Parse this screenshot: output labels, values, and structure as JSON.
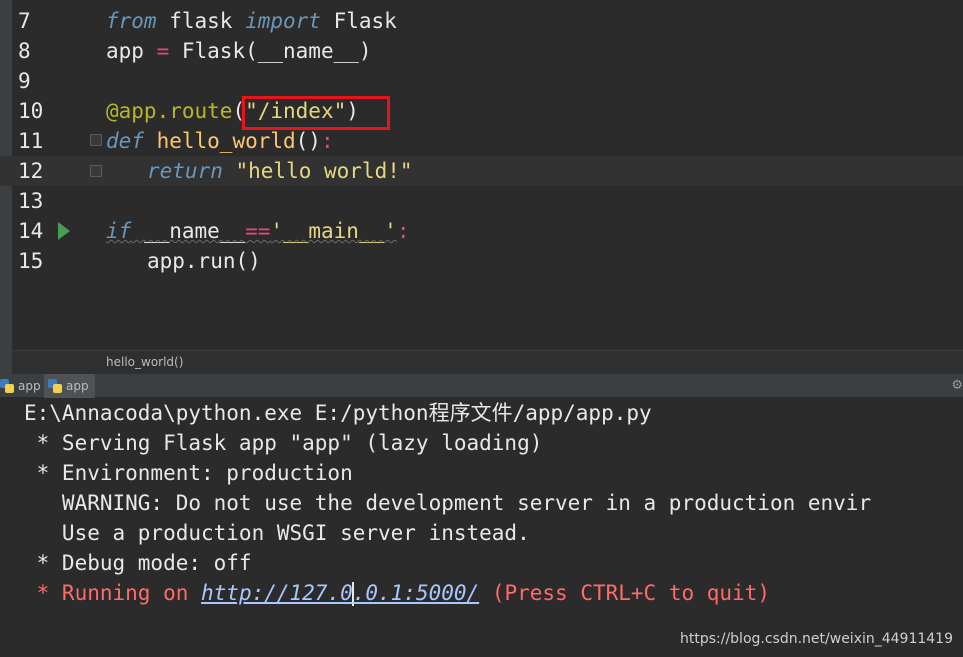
{
  "editor": {
    "lines": [
      {
        "no": "7",
        "code": {
          "kw1": "from",
          "mod": " flask ",
          "kw2": "import",
          "name": " Flask"
        }
      },
      {
        "no": "8",
        "code": {
          "lhs": "app ",
          "op": "=",
          "rhs": " Flask(__name__)"
        }
      },
      {
        "no": "9"
      },
      {
        "no": "10",
        "code": {
          "decorator": "@app.route",
          "paren_open": "(",
          "string": "\"/index\"",
          "paren_close": ")"
        }
      },
      {
        "no": "11",
        "code": {
          "kw": "def",
          "fn": " hello_world",
          "paren": "()",
          "colon": ":"
        }
      },
      {
        "no": "12",
        "code": {
          "kw": "return",
          "string": " \"hello world!\""
        }
      },
      {
        "no": "13"
      },
      {
        "no": "14",
        "code": {
          "kw": "if",
          "name": " __name__",
          "op": "==",
          "string": "'__main__'",
          "colon": ":"
        }
      },
      {
        "no": "15",
        "code": {
          "call": "app.run()"
        }
      }
    ],
    "breadcrumb": "hello_world()"
  },
  "run_tabs": [
    {
      "label": "app"
    },
    {
      "label": "app"
    }
  ],
  "console": {
    "line1": "E:\\Annacoda\\python.exe E:/python程序文件/app/app.py",
    "line2": " * Serving Flask app \"app\" (lazy loading)",
    "line3": " * Environment: production",
    "line4": "   WARNING: Do not use the development server in a production envir",
    "line5": "   Use a production WSGI server instead.",
    "line6": " * Debug mode: off",
    "line7_prefix": " * Running on ",
    "line7_link_a": "http://127.0",
    "line7_link_b": ".0.1:5000/",
    "line7_suffix": " (Press CTRL+C to quit)"
  },
  "watermark": "https://blog.csdn.net/weixin_44911419",
  "colors": {
    "highlight_box": "#e8141c",
    "run_arrow": "#499c54"
  }
}
